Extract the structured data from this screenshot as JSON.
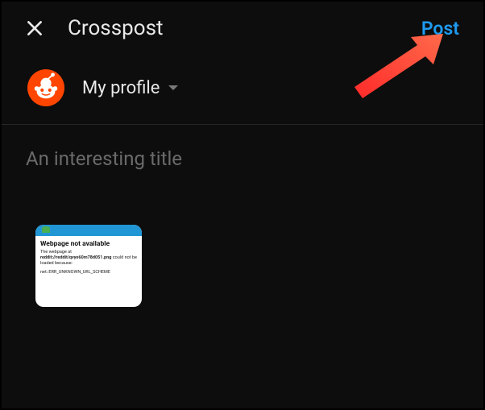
{
  "header": {
    "title": "Crosspost",
    "post_label": "Post"
  },
  "profile": {
    "label": "My profile"
  },
  "title_input": {
    "placeholder": "An interesting title"
  },
  "preview": {
    "heading": "Webpage not available",
    "body_prefix": "The webpage at ",
    "body_url": "reddit://reddit/qvye60m78d051.png",
    "body_suffix": " could not be loaded because:",
    "error": "net::ERR_UNKNOWN_URL_SCHEME"
  }
}
